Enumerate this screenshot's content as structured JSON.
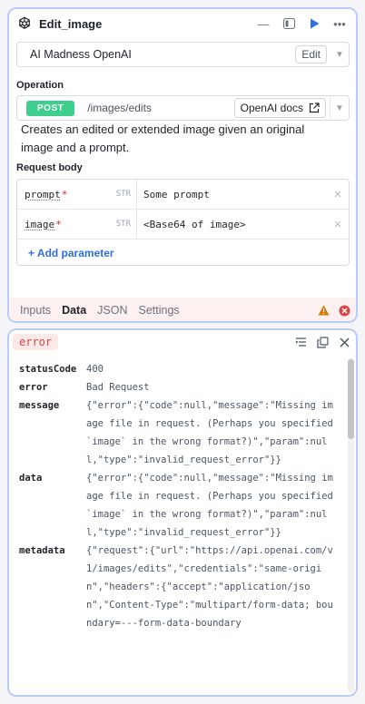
{
  "node": {
    "title": "Edit_image",
    "resource_name": "AI Madness OpenAI",
    "edit_label": "Edit"
  },
  "operation": {
    "label": "Operation",
    "method": "POST",
    "path": "/images/edits",
    "docs_label": "OpenAI docs",
    "description": "Creates an edited or extended image given an original image and a prompt."
  },
  "request_body": {
    "label": "Request body",
    "params": [
      {
        "name": "prompt",
        "required": "*",
        "type": "STR",
        "value": "Some prompt"
      },
      {
        "name": "image",
        "required": "*",
        "type": "STR",
        "value": "<Base64 of image>"
      }
    ],
    "add_label": "+ Add parameter"
  },
  "tabs": [
    {
      "label": "Inputs"
    },
    {
      "label": "Data"
    },
    {
      "label": "JSON"
    },
    {
      "label": "Settings"
    }
  ],
  "result": {
    "badge": "error",
    "rows": [
      {
        "key": "statusCode",
        "value": "400"
      },
      {
        "key": "error",
        "value": "Bad Request"
      },
      {
        "key": "message",
        "value": "{\"error\":{\"code\":null,\"message\":\"Missing image file in request. (Perhaps you specified `image` in the wrong format?)\",\"param\":null,\"type\":\"invalid_request_error\"}}"
      },
      {
        "key": "data",
        "value": "{\"error\":{\"code\":null,\"message\":\"Missing image file in request. (Perhaps you specified `image` in the wrong format?)\",\"param\":null,\"type\":\"invalid_request_error\"}}"
      },
      {
        "key": "metadata",
        "value": "{\"request\":{\"url\":\"https://api.openai.com/v1/images/edits\",\"credentials\":\"same-origin\",\"headers\":{\"accept\":\"application/json\",\"Content-Type\":\"multipart/form-data; boundary=---form-data-boundary"
      }
    ]
  },
  "colors": {
    "accent": "#2f6fdb",
    "method_post": "#3ecf8e",
    "error": "#d64545",
    "warning": "#d97706"
  }
}
